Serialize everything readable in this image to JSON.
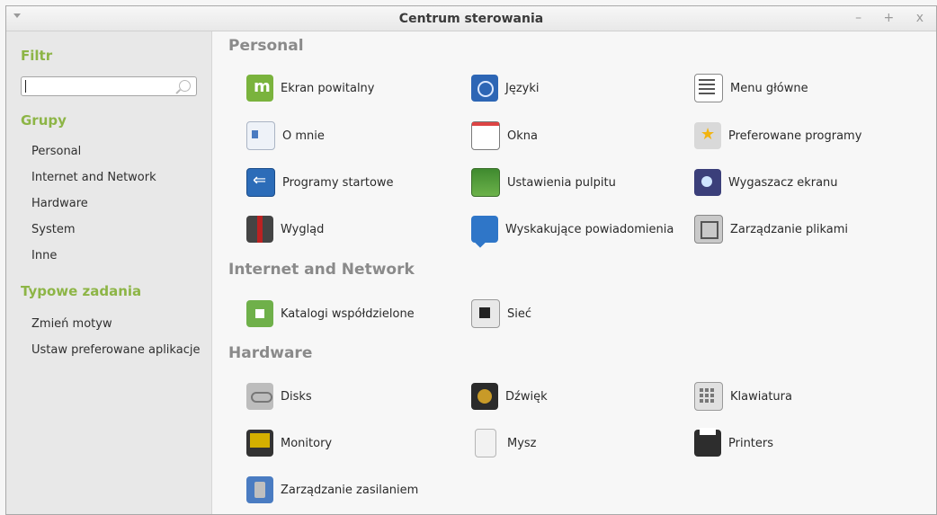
{
  "window": {
    "title": "Centrum sterowania",
    "controls": "– + x"
  },
  "sidebar": {
    "filter_heading": "Filtr",
    "search": {
      "value": "",
      "placeholder": ""
    },
    "groups_heading": "Grupy",
    "groups": [
      "Personal",
      "Internet and Network",
      "Hardware",
      "System",
      "Inne"
    ],
    "tasks_heading": "Typowe zadania",
    "tasks": [
      "Zmień motyw",
      "Ustaw preferowane aplikacje"
    ]
  },
  "sections": [
    {
      "title": "Personal",
      "items": [
        {
          "label": "Ekran powitalny",
          "icon": "mint-logo-icon"
        },
        {
          "label": "Języki",
          "icon": "globe-icon"
        },
        {
          "label": "Menu główne",
          "icon": "menu-editor-icon"
        },
        {
          "label": "O mnie",
          "icon": "user-card-icon"
        },
        {
          "label": "Okna",
          "icon": "window-icon"
        },
        {
          "label": "Preferowane programy",
          "icon": "star-icon"
        },
        {
          "label": "Programy startowe",
          "icon": "startup-icon"
        },
        {
          "label": "Ustawienia pulpitu",
          "icon": "desktop-icon"
        },
        {
          "label": "Wygaszacz ekranu",
          "icon": "screensaver-icon"
        },
        {
          "label": "Wygląd",
          "icon": "suit-icon"
        },
        {
          "label": "Wyskakujące powiadomienia",
          "icon": "notification-bubble-icon"
        },
        {
          "label": "Zarządzanie plikami",
          "icon": "file-manager-icon"
        }
      ]
    },
    {
      "title": "Internet and Network",
      "items": [
        {
          "label": "Katalogi współdzielone",
          "icon": "shared-folder-icon"
        },
        {
          "label": "Sieć",
          "icon": "network-icon"
        }
      ]
    },
    {
      "title": "Hardware",
      "items": [
        {
          "label": "Disks",
          "icon": "disks-icon"
        },
        {
          "label": "Dźwięk",
          "icon": "speaker-icon"
        },
        {
          "label": "Klawiatura",
          "icon": "keyboard-icon"
        },
        {
          "label": "Monitory",
          "icon": "monitor-icon"
        },
        {
          "label": "Mysz",
          "icon": "mouse-icon"
        },
        {
          "label": "Printers",
          "icon": "printer-icon"
        },
        {
          "label": "Zarządzanie zasilaniem",
          "icon": "power-icon"
        }
      ]
    }
  ],
  "colors": {
    "accent": "#8db546",
    "section": "#8a8a8a"
  }
}
